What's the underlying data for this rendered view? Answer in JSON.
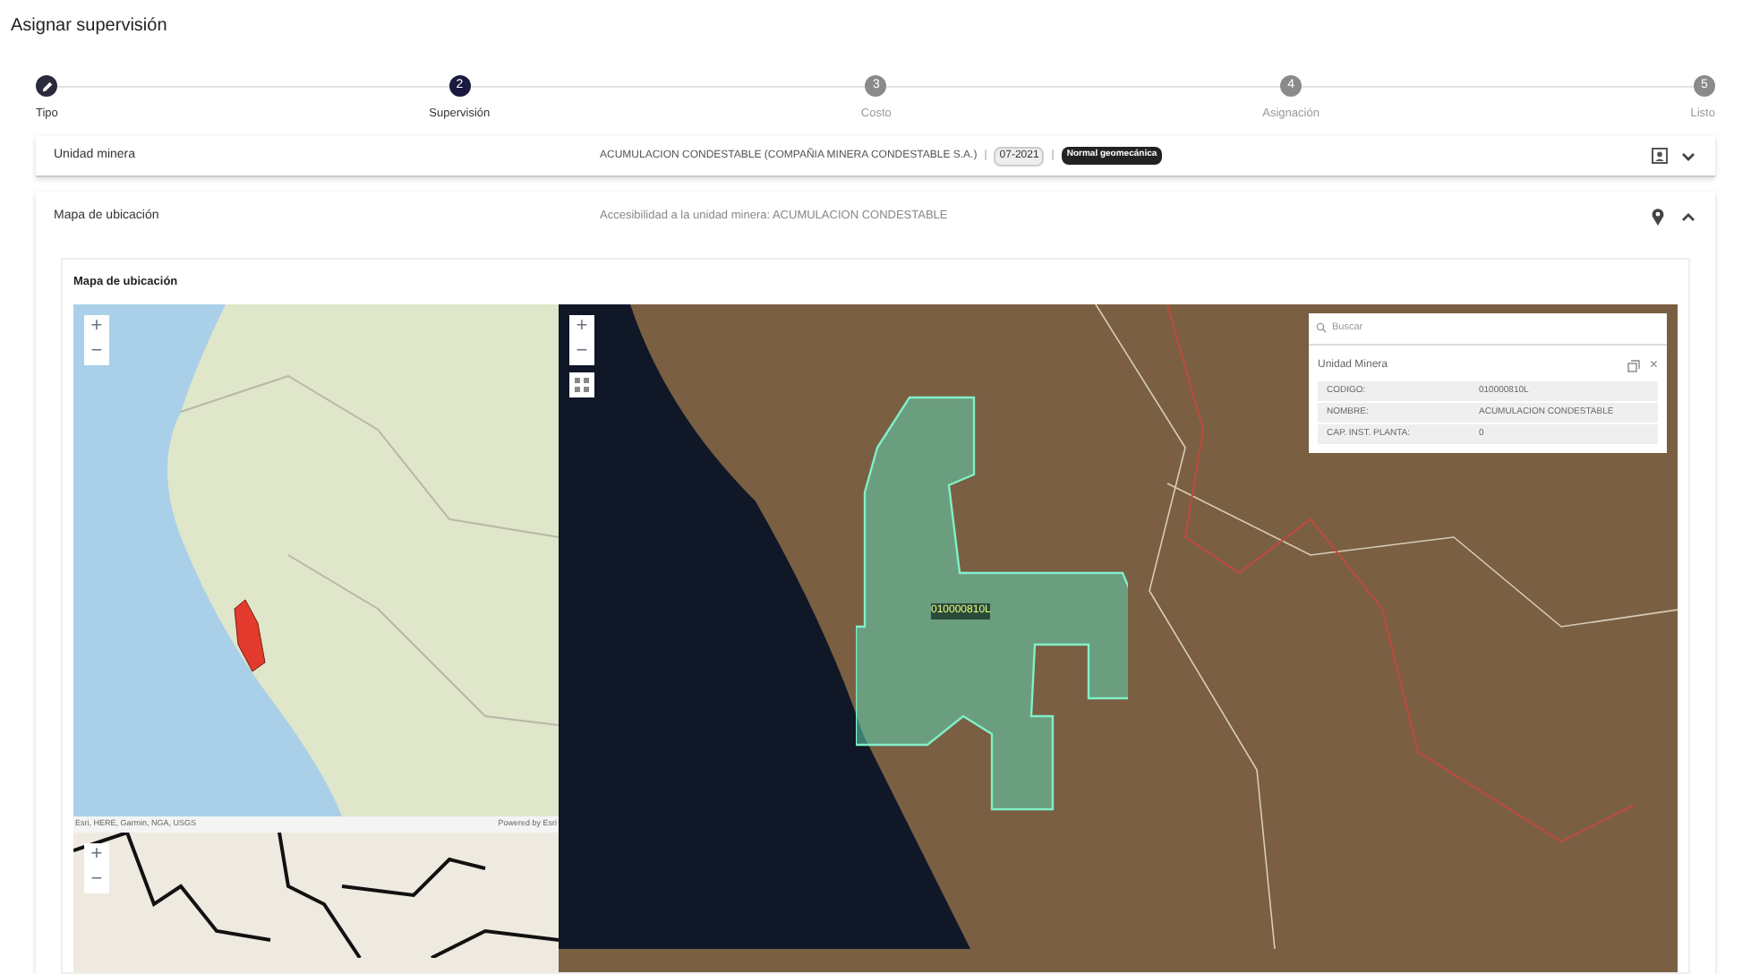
{
  "page_title": "Asignar supervisión",
  "steps": [
    {
      "label": "Tipo",
      "completed": true,
      "selected": false
    },
    {
      "label": "Supervisión",
      "number": "2",
      "completed": false,
      "selected": true
    },
    {
      "label": "Costo",
      "number": "3",
      "completed": false,
      "selected": false
    },
    {
      "label": "Asignación",
      "number": "4",
      "completed": false,
      "selected": false
    },
    {
      "label": "Listo",
      "number": "5",
      "completed": false,
      "selected": false
    }
  ],
  "unit_row": {
    "label": "Unidad minera",
    "value": "ACUMULACION CONDESTABLE (COMPAÑIA MINERA CONDESTABLE S.A.)",
    "separator": "|",
    "period": "07-2021",
    "tag": "Normal geomecánica",
    "expanded": false
  },
  "map_row": {
    "label": "Mapa de ubicación",
    "description": "Accesibilidad a la unidad minera: ACUMULACION CONDESTABLE",
    "expanded": true
  },
  "map_card": {
    "title": "Mapa de ubicación",
    "overview_map": {
      "zoom_in": "+",
      "zoom_out": "−",
      "attribution": "Esri, HERE, Garmin, NGA, USGS",
      "powered_by": "Powered by Esri"
    },
    "detail_map": {
      "zoom_in": "+",
      "zoom_out": "−"
    },
    "satellite_map": {
      "zoom_in": "+",
      "zoom_out": "−",
      "polygon_label": "010000810L",
      "popup": {
        "search_placeholder": "Buscar",
        "title": "Unidad Minera",
        "close": "×",
        "fields": [
          {
            "name": "CODIGO:",
            "value": "010000810L"
          },
          {
            "name": "NOMBRE:",
            "value": "ACUMULACION CONDESTABLE"
          },
          {
            "name": "CAP. INST. PLANTA:",
            "value": "0"
          }
        ]
      }
    }
  }
}
